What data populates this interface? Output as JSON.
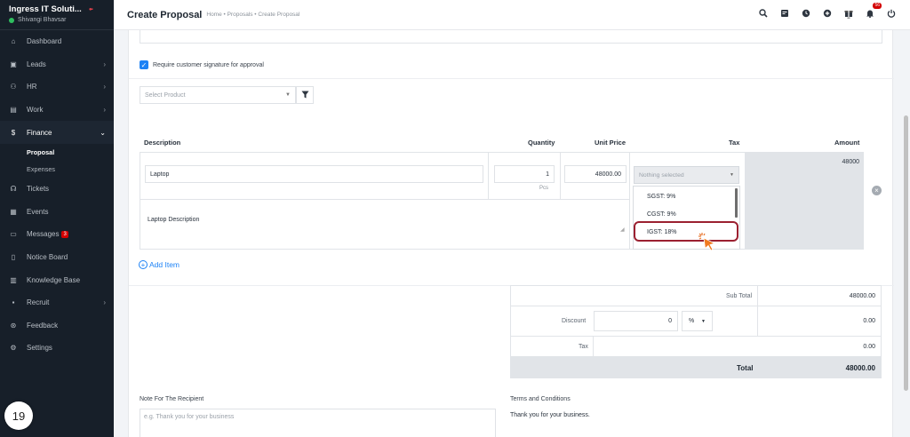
{
  "sidebar": {
    "company": "Ingress IT Soluti...",
    "user": "Shivangi Bhavsar",
    "items": [
      {
        "label": "Dashboard"
      },
      {
        "label": "Leads"
      },
      {
        "label": "HR"
      },
      {
        "label": "Work"
      },
      {
        "label": "Finance"
      },
      {
        "label": "Tickets"
      },
      {
        "label": "Events"
      },
      {
        "label": "Messages",
        "badge": "3"
      },
      {
        "label": "Notice Board"
      },
      {
        "label": "Knowledge Base"
      },
      {
        "label": "Recruit"
      },
      {
        "label": "Feedback"
      },
      {
        "label": "Settings"
      }
    ],
    "finance_sub": [
      "Proposal",
      "Expenses"
    ],
    "step_number": "19"
  },
  "header": {
    "title": "Create Proposal",
    "breadcrumb": "Home • Proposals • Create Proposal",
    "notification_count": "56"
  },
  "form": {
    "signature_label": "Require customer signature for approval",
    "signature_checked": true,
    "product_placeholder": "Select Product",
    "columns": {
      "description": "Description",
      "quantity": "Quantity",
      "unit_price": "Unit Price",
      "tax": "Tax",
      "amount": "Amount"
    },
    "item": {
      "name": "Laptop",
      "quantity": "1",
      "unit": "Pcs",
      "unit_price": "48000.00",
      "tax_placeholder": "Nothing selected",
      "description": "Laptop Description",
      "amount": "48000"
    },
    "tax_options": [
      "SGST: 9%",
      "CGST: 9%",
      "IGST: 18%"
    ],
    "add_item": "Add Item",
    "totals": {
      "sub_total_label": "Sub Total",
      "sub_total": "48000.00",
      "discount_label": "Discount",
      "discount_value": "0",
      "discount_type": "%",
      "discount_amount": "0.00",
      "tax_label": "Tax",
      "tax_amount": "0.00",
      "total_label": "Total",
      "total": "48000.00"
    },
    "note_label": "Note For The Recipient",
    "note_placeholder": "e.g. Thank you for your business",
    "terms_label": "Terms and Conditions",
    "terms_text": "Thank you for your business."
  },
  "colors": {
    "sidebar_bg": "#171f29",
    "accent": "#1d82f5",
    "highlight": "#9b2030",
    "badge": "#d30000"
  }
}
